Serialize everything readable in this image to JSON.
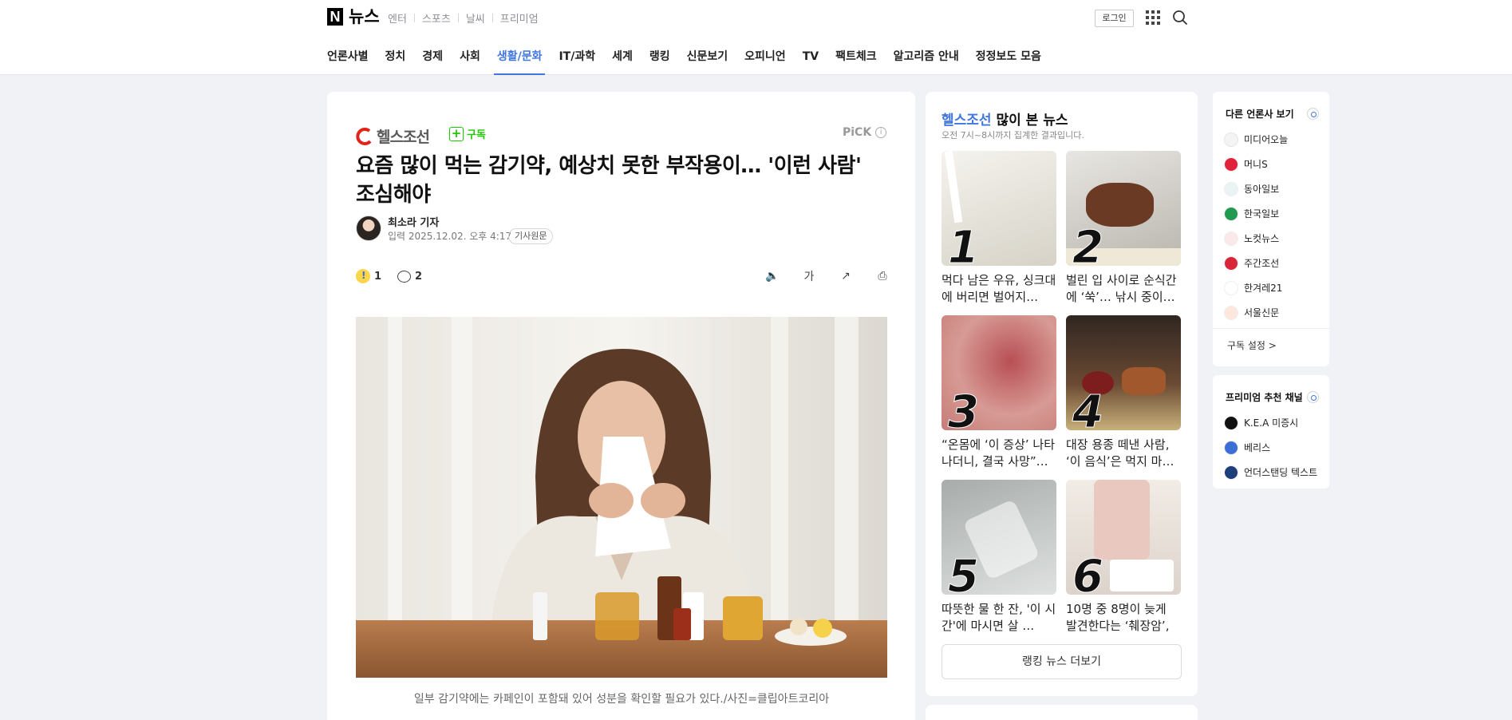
{
  "header": {
    "logo_mark": "N",
    "logo_text": "뉴스",
    "service_links": [
      "엔터",
      "스포츠",
      "날씨",
      "프리미엄"
    ],
    "login_label": "로그인"
  },
  "gnb": {
    "items": [
      "언론사별",
      "정치",
      "경제",
      "사회",
      "생활/문화",
      "IT/과학",
      "세계",
      "랭킹",
      "신문보기",
      "오피니언",
      "TV",
      "팩트체크",
      "알고리즘 안내",
      "정정보도 모음"
    ],
    "active": "생활/문화"
  },
  "article": {
    "press_name": "헬스조선",
    "subscribe_label": "구독",
    "pick_label": "PiCK",
    "pick_info": "i",
    "headline": "요즘 많이 먹는 감기약, 예상치 못한 부작용이… '이런 사람' 조심해야",
    "reporter": "최소라 기자",
    "date": "입력 2025.12.02. 오후 4:17",
    "origin_label": "기사원문",
    "reaction_count": "1",
    "comment_count": "2",
    "tools": {
      "audio": "🔈",
      "font": "가",
      "share": "↗",
      "print": "⎙"
    },
    "caption": "일부 감기약에는 카페인이 포함돼 있어 성분을 확인할 필요가 있다./사진=클립아트코리아"
  },
  "ranking": {
    "press": "헬스조선",
    "title_suffix": " 많이 본 뉴스",
    "subtitle": "오전 7시~8시까지 집계한 결과입니다.",
    "items": [
      {
        "num": "1",
        "text": "먹다 남은 우유, 싱크대에 버리면 벌어지…"
      },
      {
        "num": "2",
        "text": "벌린 입 사이로 순식간에 ‘쑥’… 낚시 중이…"
      },
      {
        "num": "3",
        "text": "“온몸에 ‘이 증상’ 나타나더니, 결국 사망”…"
      },
      {
        "num": "4",
        "text": "대장 용종 떼낸 사람, ‘이 음식’은 먹지 마…"
      },
      {
        "num": "5",
        "text": "따뜻한 물 한 잔, '이 시간'에 마시면 살 …"
      },
      {
        "num": "6",
        "text": "10명 중 8명이 늦게 발견한다는 ‘췌장암’, …"
      }
    ],
    "more_label": "랭킹 뉴스 더보기"
  },
  "other_press": {
    "title": "다른 언론사 보기",
    "items": [
      "미디어오늘",
      "머니S",
      "동아일보",
      "한국일보",
      "노컷뉴스",
      "주간조선",
      "한겨레21",
      "서울신문"
    ],
    "setting_label": "구독 설정 >"
  },
  "premium": {
    "title": "프리미엄 추천 채널",
    "items": [
      "K.E.A 미증시",
      "베리스",
      "언더스탠딩 텍스트"
    ]
  }
}
